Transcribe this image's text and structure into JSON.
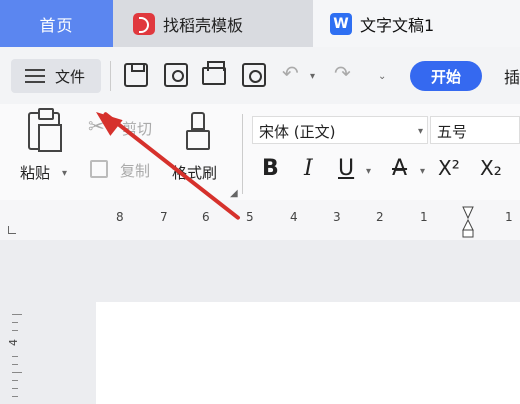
{
  "tabs": {
    "home": "首页",
    "template": "找稻壳模板",
    "document": "文字文稿1"
  },
  "toolbar": {
    "file_label": "文件",
    "start_label": "开始",
    "insert_partial": "插"
  },
  "ribbon": {
    "paste_label": "粘贴",
    "cut_label": "剪切",
    "copy_label": "复制",
    "format_painter_label": "格式刷",
    "font_name": "宋体 (正文)",
    "font_size": "五号",
    "bold": "B",
    "italic": "I",
    "underline": "U",
    "strikethrough": "A",
    "superscript": "X²",
    "subscript": "X₂"
  },
  "ruler": {
    "labels": [
      "8",
      "7",
      "6",
      "5",
      "4",
      "3",
      "2",
      "1",
      "1"
    ],
    "vertical_label": "4"
  },
  "colors": {
    "accent": "#3569f0",
    "home_tab": "#5b86f0",
    "arrow": "#d6312c"
  }
}
